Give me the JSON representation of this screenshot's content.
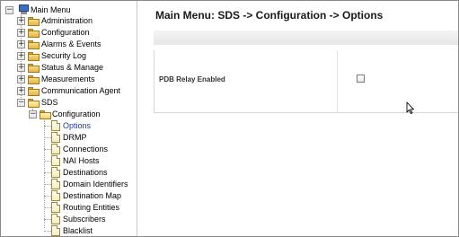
{
  "tree": {
    "root": "Main Menu",
    "items": [
      {
        "label": "Administration",
        "expander": "+"
      },
      {
        "label": "Configuration",
        "expander": "+"
      },
      {
        "label": "Alarms & Events",
        "expander": "+"
      },
      {
        "label": "Security Log",
        "expander": "+"
      },
      {
        "label": "Status & Manage",
        "expander": "+"
      },
      {
        "label": "Measurements",
        "expander": "+"
      },
      {
        "label": "Communication Agent",
        "expander": "+"
      },
      {
        "label": "SDS",
        "expander": "−"
      }
    ],
    "sds_child": {
      "label": "Configuration",
      "expander": "−"
    },
    "config_children": [
      "Options",
      "DRMP",
      "Connections",
      "NAI Hosts",
      "Destinations",
      "Domain Identifiers",
      "Destination Map",
      "Routing Entities",
      "Subscribers",
      "Blacklist"
    ],
    "selected": "Options"
  },
  "page": {
    "title": "Main Menu: SDS -> Configuration -> Options"
  },
  "options": [
    {
      "label": "PDB Relay Enabled",
      "checked": false
    }
  ],
  "colors": {
    "selected_text": "#1c3c9c",
    "folder": "#e3b64a",
    "toolbar": "#e6e6e6"
  }
}
